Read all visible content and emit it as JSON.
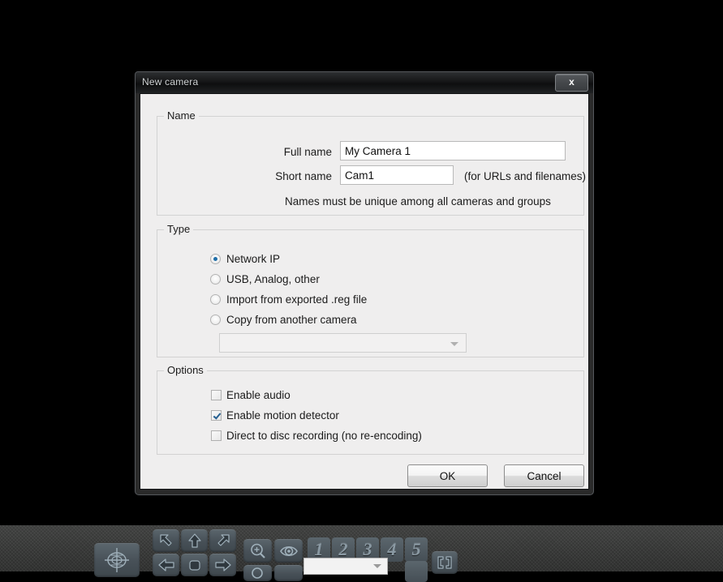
{
  "window": {
    "title": "New camera",
    "close_label": "x"
  },
  "name_group": {
    "legend": "Name",
    "full_name_label": "Full name",
    "full_name_value": "My Camera 1",
    "short_name_label": "Short name",
    "short_name_value": "Cam1",
    "short_name_hint": "(for URLs and filenames)",
    "uniqueness_hint": "Names must be unique among all cameras and groups"
  },
  "type_group": {
    "legend": "Type",
    "options": [
      {
        "label": "Network IP",
        "checked": true
      },
      {
        "label": "USB, Analog, other",
        "checked": false
      },
      {
        "label": "Import from exported .reg file",
        "checked": false
      },
      {
        "label": "Copy from another camera",
        "checked": false
      }
    ],
    "copy_from_combo_value": "",
    "copy_from_combo_enabled": false
  },
  "options_group": {
    "legend": "Options",
    "items": [
      {
        "label": "Enable audio",
        "checked": false
      },
      {
        "label": "Enable motion detector",
        "checked": true
      },
      {
        "label": "Direct to disc recording (no re-encoding)",
        "checked": false
      }
    ]
  },
  "buttons": {
    "ok_label": "OK",
    "cancel_label": "Cancel"
  },
  "background_toolbar": {
    "preset_numbers": [
      "1",
      "2",
      "3",
      "4",
      "5"
    ],
    "ptz_combo_value": ""
  },
  "colors": {
    "dialog_body": "#efeeee",
    "titlebar": "#151617",
    "accent_blue": "#1f6ea8",
    "check_blue": "#245f91",
    "panel": "#3a3b3a",
    "ptz_button": "#4a535a"
  }
}
